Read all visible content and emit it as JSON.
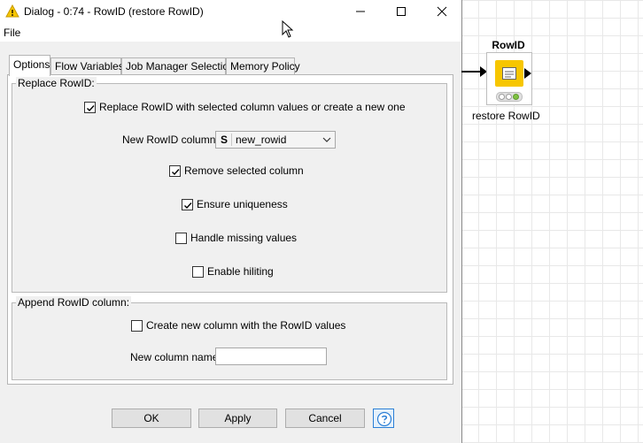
{
  "window": {
    "title": "Dialog - 0:74 - RowID (restore RowID)",
    "menu": [
      "File"
    ]
  },
  "tabs": [
    {
      "label": "Options",
      "active": true
    },
    {
      "label": "Flow Variables",
      "active": false
    },
    {
      "label": "Job Manager Selection",
      "active": false
    },
    {
      "label": "Memory Policy",
      "active": false
    }
  ],
  "replace_group": {
    "title": "Replace RowID:",
    "replace_checkbox": {
      "label": "Replace RowID with selected column values or create a new one",
      "checked": true
    },
    "new_rowid_label": "New RowID column:",
    "new_rowid_select": {
      "type_badge": "S",
      "value": "new_rowid"
    },
    "remove_column": {
      "label": "Remove selected column",
      "checked": true
    },
    "ensure_uniqueness": {
      "label": "Ensure uniqueness",
      "checked": true
    },
    "handle_missing": {
      "label": "Handle missing values",
      "checked": false
    },
    "enable_hiliting": {
      "label": "Enable hiliting",
      "checked": false
    }
  },
  "append_group": {
    "title": "Append RowID column:",
    "create_column": {
      "label": "Create new column with the RowID values",
      "checked": false
    },
    "new_column_name_label": "New column name:",
    "new_column_name_value": ""
  },
  "buttons": {
    "ok": "OK",
    "apply": "Apply",
    "cancel": "Cancel"
  },
  "node": {
    "title": "RowID",
    "label": "restore RowID",
    "color": "#f7c600"
  }
}
